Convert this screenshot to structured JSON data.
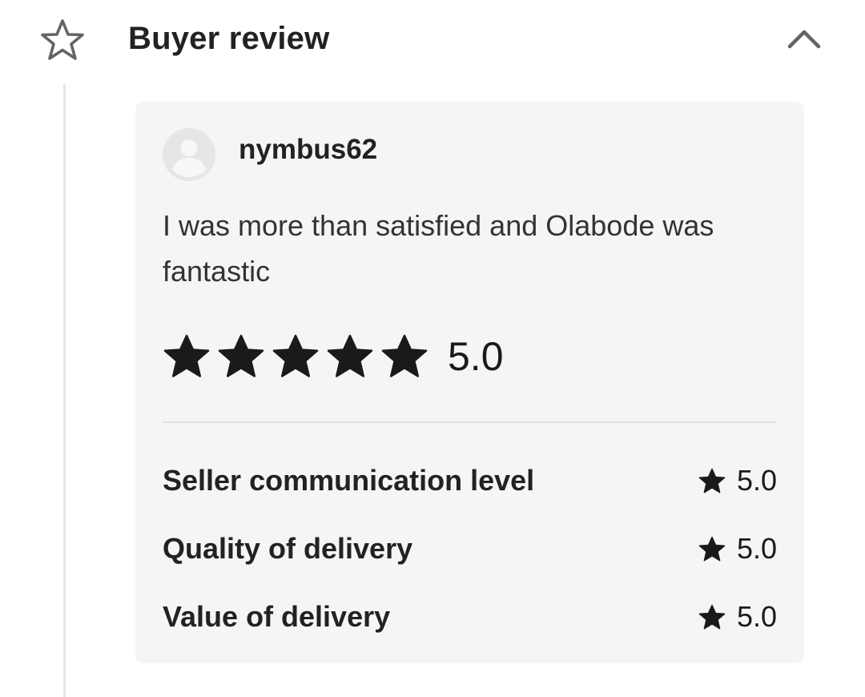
{
  "header": {
    "title": "Buyer review",
    "icon": "star-outline-icon",
    "toggle_icon": "chevron-up-icon"
  },
  "review": {
    "username": "nymbus62",
    "avatar_icon": "user-avatar-icon",
    "text": "I was more than satisfied and Olabode was fantastic",
    "overall_rating": 5.0,
    "overall_rating_label": "5.0",
    "stars_filled": 5,
    "stars_total": 5,
    "sub_ratings": [
      {
        "label": "Seller communication level",
        "value": "5.0"
      },
      {
        "label": "Quality of delivery",
        "value": "5.0"
      },
      {
        "label": "Value of delivery",
        "value": "5.0"
      }
    ]
  },
  "colors": {
    "star_fill": "#1a1a1a",
    "card_background": "#f5f5f5",
    "timeline": "#e4e5e7",
    "icon_outline": "#62646a"
  }
}
